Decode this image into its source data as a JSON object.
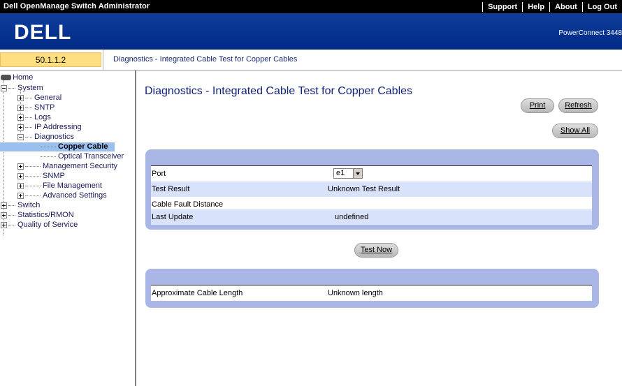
{
  "topbar": {
    "title": "Dell OpenManage Switch Administrator",
    "menu": [
      "Support",
      "Help",
      "About",
      "Log Out"
    ]
  },
  "header": {
    "logo": "DELL",
    "product": "PowerConnect 3448"
  },
  "address": {
    "ip": "50.1.1.2",
    "breadcrumb": "Diagnostics - Integrated Cable Test for Copper Cables"
  },
  "tree": {
    "home": "Home",
    "system": "System",
    "general": "General",
    "sntp": "SNTP",
    "logs": "Logs",
    "ip_addressing": "IP Addressing",
    "diagnostics": "Diagnostics",
    "copper_cable": "Copper Cable",
    "optical_transceiver": "Optical Transceiver",
    "management_security": "Management Security",
    "snmp": "SNMP",
    "file_management": "File Management",
    "advanced_settings": "Advanced Settings",
    "switch": "Switch",
    "statistics_rmon": "Statistics/RMON",
    "qos": "Quality of Service"
  },
  "main": {
    "title": "Diagnostics - Integrated Cable Test for Copper Cables",
    "print_label": "Print",
    "refresh_label": "Refresh",
    "show_all_label": "Show All",
    "test_now_label": "Test Now",
    "fields": {
      "port_label": "Port",
      "port_value": "e1",
      "test_result_label": "Test Result",
      "test_result_value": "Unknown Test Result",
      "cable_fault_label": "Cable Fault Distance",
      "cable_fault_value": "",
      "last_update_label": "Last Update",
      "last_update_value": "undefined"
    },
    "length": {
      "label": "Approximate Cable Length",
      "value": "Unknown length"
    }
  }
}
